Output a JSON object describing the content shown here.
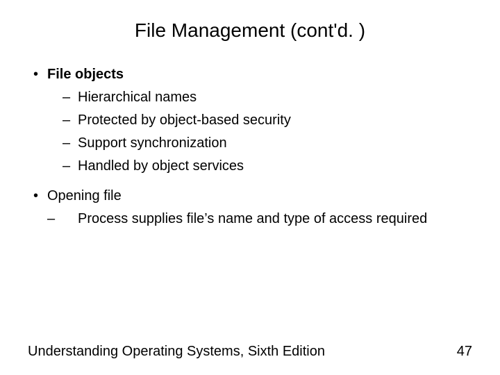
{
  "title": "File Management (cont'd. )",
  "bullets": {
    "b1": {
      "label": "File objects"
    },
    "b1subs": {
      "s1": "Hierarchical names",
      "s2": "Protected by object-based security",
      "s3": "Support synchronization",
      "s4": "Handled by object services"
    },
    "b2": {
      "label": "Opening file"
    },
    "b2subs": {
      "s1": "Process supplies file’s name and type of access required"
    }
  },
  "footer": {
    "source": "Understanding Operating Systems, Sixth Edition",
    "page": "47"
  },
  "glyphs": {
    "bullet": "•",
    "dash": "–"
  }
}
